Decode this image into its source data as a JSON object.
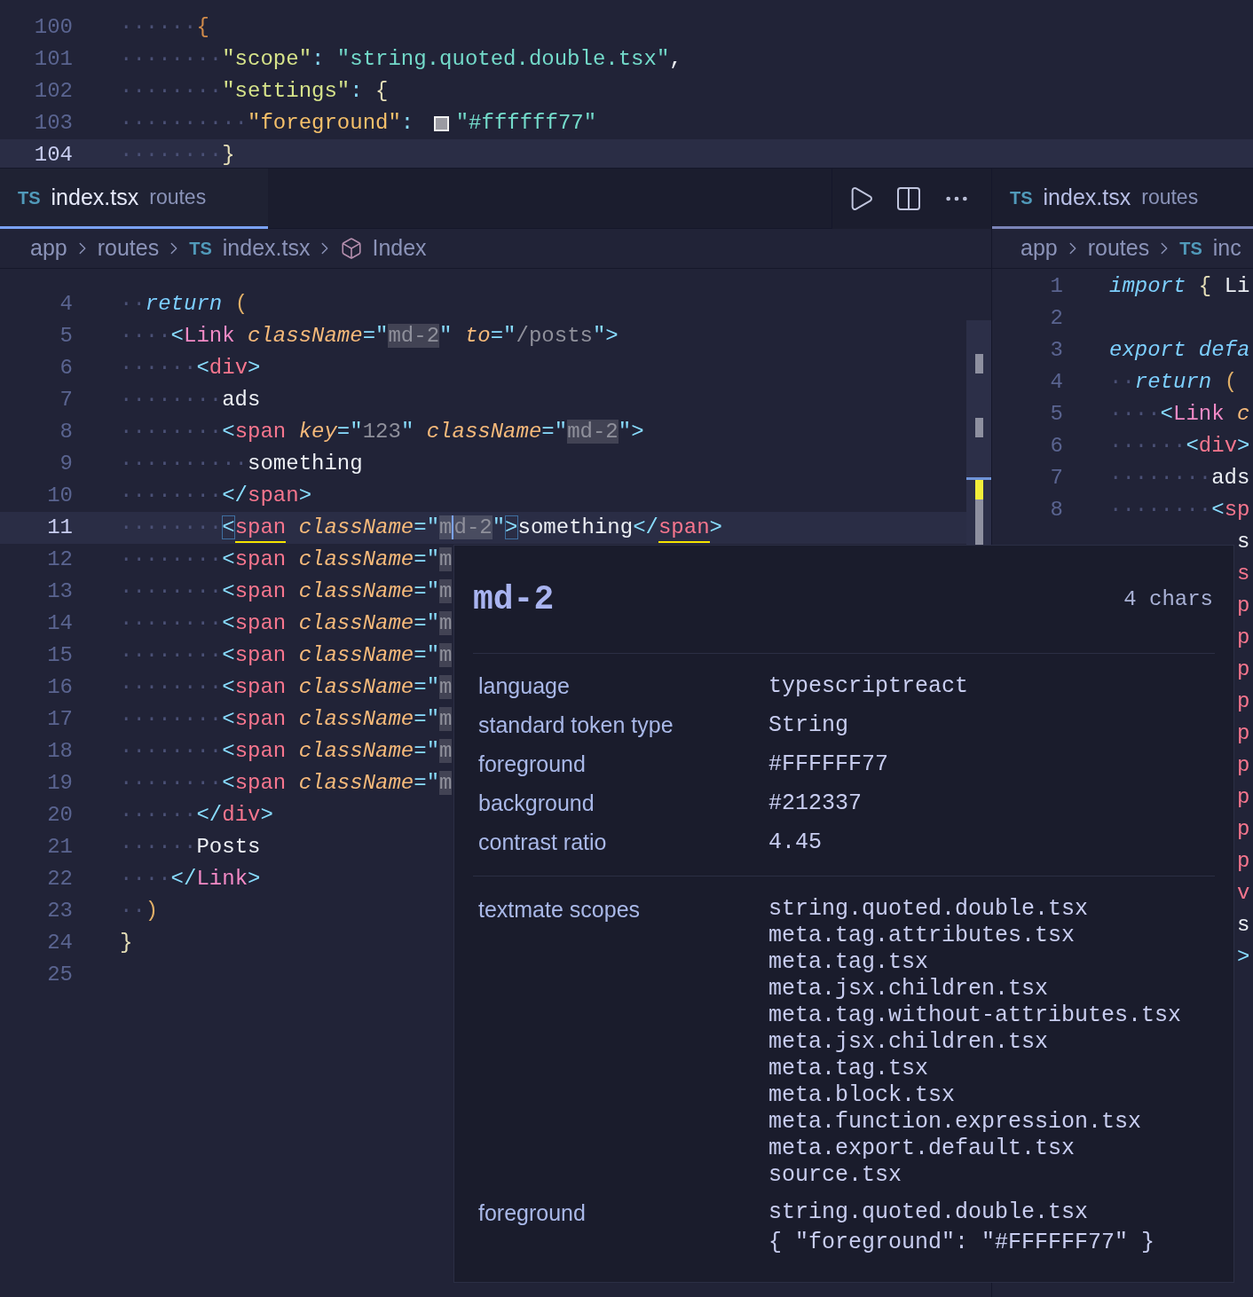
{
  "top_editor": {
    "lines": [
      {
        "number": "100",
        "active": false,
        "tokens": [
          {
            "kind": "ws",
            "text": "······"
          },
          {
            "kind": "jbrace",
            "text": "{"
          }
        ]
      },
      {
        "number": "101",
        "active": false,
        "tokens": [
          {
            "kind": "ws",
            "text": "········"
          },
          {
            "kind": "jkey",
            "text": "\"scope\""
          },
          {
            "kind": "punct",
            "text": ": "
          },
          {
            "kind": "jstr",
            "text": "\"string.quoted.double.tsx\""
          },
          {
            "kind": "text",
            "text": ","
          }
        ]
      },
      {
        "number": "102",
        "active": false,
        "tokens": [
          {
            "kind": "ws",
            "text": "········"
          },
          {
            "kind": "jkey",
            "text": "\"settings\""
          },
          {
            "kind": "punct",
            "text": ": "
          },
          {
            "kind": "brace",
            "text": "{"
          }
        ]
      },
      {
        "number": "103",
        "active": false,
        "tokens": [
          {
            "kind": "ws",
            "text": "··········"
          },
          {
            "kind": "jkey2",
            "text": "\"foreground\""
          },
          {
            "kind": "punct",
            "text": ": "
          },
          {
            "kind": "swatch"
          },
          {
            "kind": "jstr",
            "text": "\"#ffffff77\""
          }
        ]
      },
      {
        "number": "104",
        "active": true,
        "tokens": [
          {
            "kind": "ws",
            "text": "········"
          },
          {
            "kind": "brace",
            "text": "}"
          }
        ]
      }
    ]
  },
  "left_group": {
    "tabs": [
      {
        "badge": "TS",
        "name": "index.tsx",
        "detail": "routes",
        "selected": true
      }
    ],
    "actions": [
      {
        "kind": "run"
      },
      {
        "kind": "split"
      },
      {
        "kind": "more"
      }
    ],
    "breadcrumb": [
      {
        "kind": "folder",
        "text": "app"
      },
      {
        "kind": "folder",
        "text": "routes"
      },
      {
        "kind": "file",
        "badge": "TS",
        "text": "index.tsx"
      },
      {
        "kind": "symbol",
        "text": "Index"
      }
    ],
    "lines": [
      {
        "number": "4",
        "active": false,
        "tokens": [
          {
            "kind": "ws",
            "text": "··"
          },
          {
            "kind": "kw",
            "text": "return "
          },
          {
            "kind": "paren",
            "text": "("
          }
        ]
      },
      {
        "number": "5",
        "active": false,
        "tokens": [
          {
            "kind": "ws",
            "text": "····"
          },
          {
            "kind": "punct",
            "text": "<"
          },
          {
            "kind": "comp",
            "text": "Link "
          },
          {
            "kind": "attr",
            "text": "className"
          },
          {
            "kind": "punct",
            "text": "=\""
          },
          {
            "kind": "strhl",
            "text": "md-2"
          },
          {
            "kind": "punct",
            "text": "\" "
          },
          {
            "kind": "attr",
            "text": "to"
          },
          {
            "kind": "punct",
            "text": "=\""
          },
          {
            "kind": "str",
            "text": "/posts"
          },
          {
            "kind": "punct",
            "text": "\">"
          }
        ]
      },
      {
        "number": "6",
        "active": false,
        "tokens": [
          {
            "kind": "ws",
            "text": "······"
          },
          {
            "kind": "punct",
            "text": "<"
          },
          {
            "kind": "tag",
            "text": "div"
          },
          {
            "kind": "punct",
            "text": ">"
          }
        ]
      },
      {
        "number": "7",
        "active": false,
        "tokens": [
          {
            "kind": "ws",
            "text": "········"
          },
          {
            "kind": "text",
            "text": "ads"
          }
        ]
      },
      {
        "number": "8",
        "active": false,
        "tokens": [
          {
            "kind": "ws",
            "text": "········"
          },
          {
            "kind": "punct",
            "text": "<"
          },
          {
            "kind": "tag",
            "text": "span "
          },
          {
            "kind": "attr",
            "text": "key"
          },
          {
            "kind": "punct",
            "text": "=\""
          },
          {
            "kind": "str",
            "text": "123"
          },
          {
            "kind": "punct",
            "text": "\" "
          },
          {
            "kind": "attr",
            "text": "className"
          },
          {
            "kind": "punct",
            "text": "=\""
          },
          {
            "kind": "strhl",
            "text": "md-2"
          },
          {
            "kind": "punct",
            "text": "\">"
          }
        ]
      },
      {
        "number": "9",
        "active": false,
        "tokens": [
          {
            "kind": "ws",
            "text": "··········"
          },
          {
            "kind": "text",
            "text": "something"
          }
        ]
      },
      {
        "number": "10",
        "active": false,
        "tokens": [
          {
            "kind": "ws",
            "text": "········"
          },
          {
            "kind": "punct",
            "text": "</"
          },
          {
            "kind": "tag",
            "text": "span"
          },
          {
            "kind": "punct",
            "text": ">"
          }
        ]
      },
      {
        "number": "11",
        "active": true,
        "tokens": [
          {
            "kind": "ws",
            "text": "········"
          },
          {
            "kind": "punct",
            "text": "<",
            "boxed": true
          },
          {
            "kind": "tag",
            "text": "span",
            "underline": true
          },
          {
            "kind": "attr",
            "text": " className"
          },
          {
            "kind": "punct",
            "text": "=\""
          },
          {
            "kind": "strhl",
            "text": "m"
          },
          {
            "kind": "strhl",
            "text": "d-2",
            "cursor": true
          },
          {
            "kind": "punct",
            "text": "\""
          },
          {
            "kind": "punct",
            "text": ">",
            "boxed": true
          },
          {
            "kind": "text",
            "text": "something"
          },
          {
            "kind": "punct",
            "text": "</"
          },
          {
            "kind": "tag",
            "text": "span",
            "underline": true
          },
          {
            "kind": "punct",
            "text": ">"
          }
        ]
      },
      {
        "number": "12",
        "active": false,
        "tokens": [
          {
            "kind": "ws",
            "text": "········"
          },
          {
            "kind": "punct",
            "text": "<"
          },
          {
            "kind": "tag",
            "text": "span "
          },
          {
            "kind": "attr",
            "text": "className"
          },
          {
            "kind": "punct",
            "text": "=\""
          },
          {
            "kind": "strhl",
            "text": "m"
          }
        ]
      },
      {
        "number": "13",
        "active": false,
        "tokens": [
          {
            "kind": "ws",
            "text": "········"
          },
          {
            "kind": "punct",
            "text": "<"
          },
          {
            "kind": "tag",
            "text": "span "
          },
          {
            "kind": "attr",
            "text": "className"
          },
          {
            "kind": "punct",
            "text": "=\""
          },
          {
            "kind": "strhl",
            "text": "m"
          }
        ]
      },
      {
        "number": "14",
        "active": false,
        "tokens": [
          {
            "kind": "ws",
            "text": "········"
          },
          {
            "kind": "punct",
            "text": "<"
          },
          {
            "kind": "tag",
            "text": "span "
          },
          {
            "kind": "attr",
            "text": "className"
          },
          {
            "kind": "punct",
            "text": "=\""
          },
          {
            "kind": "strhl",
            "text": "m"
          }
        ]
      },
      {
        "number": "15",
        "active": false,
        "tokens": [
          {
            "kind": "ws",
            "text": "········"
          },
          {
            "kind": "punct",
            "text": "<"
          },
          {
            "kind": "tag",
            "text": "span "
          },
          {
            "kind": "attr",
            "text": "className"
          },
          {
            "kind": "punct",
            "text": "=\""
          },
          {
            "kind": "strhl",
            "text": "m"
          }
        ]
      },
      {
        "number": "16",
        "active": false,
        "tokens": [
          {
            "kind": "ws",
            "text": "········"
          },
          {
            "kind": "punct",
            "text": "<"
          },
          {
            "kind": "tag",
            "text": "span "
          },
          {
            "kind": "attr",
            "text": "className"
          },
          {
            "kind": "punct",
            "text": "=\""
          },
          {
            "kind": "strhl",
            "text": "m"
          }
        ]
      },
      {
        "number": "17",
        "active": false,
        "tokens": [
          {
            "kind": "ws",
            "text": "········"
          },
          {
            "kind": "punct",
            "text": "<"
          },
          {
            "kind": "tag",
            "text": "span "
          },
          {
            "kind": "attr",
            "text": "className"
          },
          {
            "kind": "punct",
            "text": "=\""
          },
          {
            "kind": "strhl",
            "text": "m"
          }
        ]
      },
      {
        "number": "18",
        "active": false,
        "tokens": [
          {
            "kind": "ws",
            "text": "········"
          },
          {
            "kind": "punct",
            "text": "<"
          },
          {
            "kind": "tag",
            "text": "span "
          },
          {
            "kind": "attr",
            "text": "className"
          },
          {
            "kind": "punct",
            "text": "=\""
          },
          {
            "kind": "strhl",
            "text": "m"
          }
        ]
      },
      {
        "number": "19",
        "active": false,
        "tokens": [
          {
            "kind": "ws",
            "text": "········"
          },
          {
            "kind": "punct",
            "text": "<"
          },
          {
            "kind": "tag",
            "text": "span "
          },
          {
            "kind": "attr",
            "text": "className"
          },
          {
            "kind": "punct",
            "text": "=\""
          },
          {
            "kind": "strhl",
            "text": "m"
          }
        ]
      },
      {
        "number": "20",
        "active": false,
        "tokens": [
          {
            "kind": "ws",
            "text": "······"
          },
          {
            "kind": "punct",
            "text": "</"
          },
          {
            "kind": "tag",
            "text": "div"
          },
          {
            "kind": "punct",
            "text": ">"
          }
        ]
      },
      {
        "number": "21",
        "active": false,
        "tokens": [
          {
            "kind": "ws",
            "text": "······"
          },
          {
            "kind": "text",
            "text": "Posts"
          }
        ]
      },
      {
        "number": "22",
        "active": false,
        "tokens": [
          {
            "kind": "ws",
            "text": "····"
          },
          {
            "kind": "punct",
            "text": "</"
          },
          {
            "kind": "comp",
            "text": "Link"
          },
          {
            "kind": "punct",
            "text": ">"
          }
        ]
      },
      {
        "number": "23",
        "active": false,
        "tokens": [
          {
            "kind": "ws",
            "text": "··"
          },
          {
            "kind": "paren",
            "text": ")"
          }
        ]
      },
      {
        "number": "24",
        "active": false,
        "tokens": [
          {
            "kind": "brace",
            "text": "}"
          }
        ]
      },
      {
        "number": "25",
        "active": false
      }
    ]
  },
  "right_group": {
    "tabs": [
      {
        "badge": "TS",
        "name": "index.tsx",
        "detail": "routes",
        "selected": false
      }
    ],
    "breadcrumb": [
      {
        "kind": "folder",
        "text": "app"
      },
      {
        "kind": "folder",
        "text": "routes"
      },
      {
        "kind": "file",
        "badge": "TS",
        "text": "inc"
      }
    ],
    "lines": [
      {
        "number": "1",
        "active": false,
        "tokens": [
          {
            "kind": "kw",
            "text": "import "
          },
          {
            "kind": "brace",
            "text": "{ "
          },
          {
            "kind": "text",
            "text": "Li"
          }
        ]
      },
      {
        "number": "2",
        "active": false
      },
      {
        "number": "3",
        "active": false,
        "tokens": [
          {
            "kind": "kw",
            "text": "export defa"
          }
        ]
      },
      {
        "number": "4",
        "active": false,
        "tokens": [
          {
            "kind": "ws",
            "text": "··"
          },
          {
            "kind": "kw",
            "text": "return "
          },
          {
            "kind": "paren",
            "text": "("
          }
        ]
      },
      {
        "number": "5",
        "active": false,
        "tokens": [
          {
            "kind": "ws",
            "text": "····"
          },
          {
            "kind": "punct",
            "text": "<"
          },
          {
            "kind": "comp",
            "text": "Link "
          },
          {
            "kind": "attr",
            "text": "c"
          }
        ]
      },
      {
        "number": "6",
        "active": false,
        "tokens": [
          {
            "kind": "ws",
            "text": "······"
          },
          {
            "kind": "punct",
            "text": "<"
          },
          {
            "kind": "tag",
            "text": "div"
          },
          {
            "kind": "punct",
            "text": ">"
          }
        ]
      },
      {
        "number": "7",
        "active": false,
        "tokens": [
          {
            "kind": "ws",
            "text": "········"
          },
          {
            "kind": "text",
            "text": "ads"
          }
        ]
      },
      {
        "number": "8",
        "active": false,
        "tokens": [
          {
            "kind": "ws",
            "text": "········"
          },
          {
            "kind": "punct",
            "text": "<"
          },
          {
            "kind": "tag",
            "text": "sp"
          }
        ]
      }
    ],
    "edge_fragments": [
      {
        "kind": "text",
        "text": "s"
      },
      {
        "kind": "tag",
        "text": "s"
      },
      {
        "kind": "tag",
        "text": "p"
      },
      {
        "kind": "tag",
        "text": "p"
      },
      {
        "kind": "tag",
        "text": "p"
      },
      {
        "kind": "tag",
        "text": "p"
      },
      {
        "kind": "tag",
        "text": "p"
      },
      {
        "kind": "tag",
        "text": "p"
      },
      {
        "kind": "tag",
        "text": "p"
      },
      {
        "kind": "tag",
        "text": "p"
      },
      {
        "kind": "tag",
        "text": "p"
      },
      {
        "kind": "tag",
        "text": "v"
      },
      {
        "kind": "text",
        "text": "s"
      },
      {
        "kind": "punct",
        "text": ">"
      }
    ]
  },
  "hover": {
    "title": "md-2",
    "count": "4 chars",
    "properties": [
      {
        "label": "language",
        "value": "typescriptreact"
      },
      {
        "label": "standard token type",
        "value": "String"
      },
      {
        "label": "foreground",
        "value": "#FFFFFF77"
      },
      {
        "label": "background",
        "value": "#212337"
      },
      {
        "label": "contrast ratio",
        "value": "4.45"
      }
    ],
    "scopes_label": "textmate scopes",
    "scopes": [
      "string.quoted.double.tsx",
      "meta.tag.attributes.tsx",
      "meta.tag.tsx",
      "meta.jsx.children.tsx",
      "meta.tag.without-attributes.tsx",
      "meta.jsx.children.tsx",
      "meta.tag.tsx",
      "meta.block.tsx",
      "meta.function.expression.tsx",
      "meta.export.default.tsx",
      "source.tsx"
    ],
    "rule_label": "foreground",
    "rule_lines": [
      "string.quoted.double.tsx",
      "{ \"foreground\": \"#FFFFFF77\" }"
    ]
  }
}
